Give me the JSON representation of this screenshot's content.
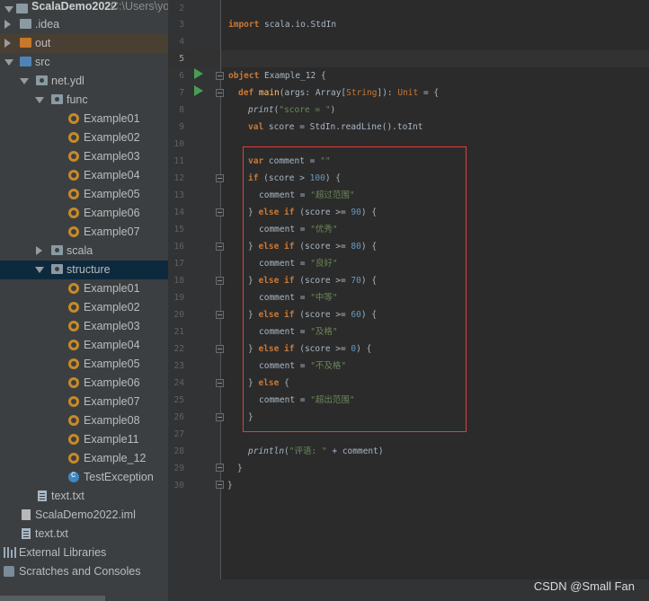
{
  "tree": {
    "project": {
      "name": "ScalaDemo2022",
      "path": "C:\\Users\\yo"
    },
    "idea": ".idea",
    "out": "out",
    "src": "src",
    "pkg": "net.ydl",
    "func": {
      "label": "func",
      "items": [
        "Example01",
        "Example02",
        "Example03",
        "Example04",
        "Example05",
        "Example06",
        "Example07"
      ]
    },
    "scala": "scala",
    "structure": {
      "label": "structure",
      "items": [
        "Example01",
        "Example02",
        "Example03",
        "Example04",
        "Example05",
        "Example06",
        "Example07",
        "Example08",
        "Example11",
        "Example_12"
      ],
      "test": "TestException"
    },
    "pkg_text": "text.txt",
    "iml": "ScalaDemo2022.iml",
    "root_text": "text.txt",
    "ext_libs": "External Libraries",
    "scratches": "Scratches and Consoles"
  },
  "editor": {
    "line_numbers": [
      "2",
      "3",
      "4",
      "5",
      "6",
      "7",
      "8",
      "9",
      "10",
      "11",
      "12",
      "13",
      "14",
      "15",
      "16",
      "17",
      "18",
      "19",
      "20",
      "21",
      "22",
      "23",
      "24",
      "25",
      "26",
      "27",
      "28",
      "29",
      "30"
    ],
    "code": {
      "import_kw": "import",
      "import_path": " scala.io.StdIn",
      "object_kw": "object",
      "object_name": " Example_12 {",
      "def_kw": "def",
      "main_fn": " main",
      "main_args": "(args: Array[",
      "string_t": "String",
      "main_ret": "]): ",
      "unit_t": "Unit",
      "main_end": " = {",
      "print_fn": "print",
      "print_open": "(",
      "print_str": "\"score = \"",
      "print_close": ")",
      "val_kw": "val",
      "val_rest": " score = StdIn.readLine().toInt",
      "var_kw": "var",
      "var_rest": " comment = ",
      "empty_str": "\"\"",
      "if_kw": "if",
      "if_cond": " (score > ",
      "n100": "100",
      "cond_end": ") {",
      "comment_assign": "comment = ",
      "s1": "\"超过范围\"",
      "s2": "\"优秀\"",
      "s3": "\"良好\"",
      "s4": "\"中等\"",
      "s5": "\"及格\"",
      "s6": "\"不及格\"",
      "s7": "\"超出范围\"",
      "close_brace": "} ",
      "else_kw": "else",
      "elif_kw": "else if",
      "ge": " (score >= ",
      "n90": "90",
      "n80": "80",
      "n70": "70",
      "n60": "60",
      "n0": "0",
      "else_open": " {",
      "brace": "}",
      "println_fn": "println",
      "println_open": "(",
      "println_str": "\"评语: \"",
      "println_rest": " + comment)"
    }
  },
  "watermark": "CSDN @Small Fan"
}
